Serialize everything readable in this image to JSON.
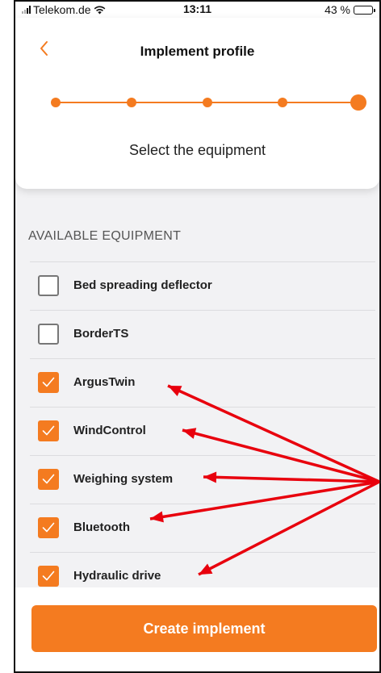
{
  "status_bar": {
    "carrier": "Telekom.de",
    "time": "13:11",
    "battery_text": "43 %",
    "battery_level": 0.43
  },
  "header": {
    "title": "Implement profile",
    "step_prompt": "Select the equipment",
    "total_steps": 5,
    "current_step": 5
  },
  "section": {
    "title": "AVAILABLE EQUIPMENT"
  },
  "equipment": [
    {
      "label": "Bed spreading deflector",
      "checked": false
    },
    {
      "label": "BorderTS",
      "checked": false
    },
    {
      "label": "ArgusTwin",
      "checked": true
    },
    {
      "label": "WindControl",
      "checked": true
    },
    {
      "label": "Weighing system",
      "checked": true
    },
    {
      "label": "Bluetooth",
      "checked": true
    },
    {
      "label": "Hydraulic drive",
      "checked": true
    }
  ],
  "footer": {
    "create_label": "Create implement"
  },
  "colors": {
    "accent": "#f47b20",
    "annotation_arrow": "#e8000d",
    "background": "#f2f2f4"
  },
  "icons": {
    "back": "chevron-left-icon",
    "check": "checkmark-icon",
    "wifi": "wifi-icon",
    "battery": "battery-icon",
    "signal": "signal-bars-icon"
  }
}
